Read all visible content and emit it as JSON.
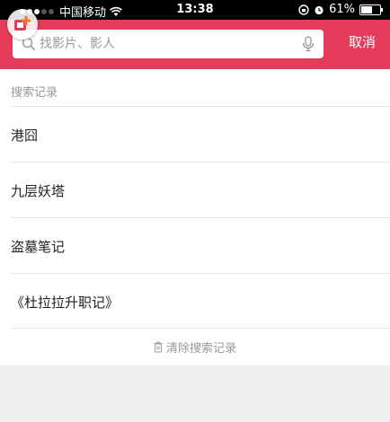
{
  "status_bar": {
    "carrier": "中国移动",
    "time": "13:38",
    "battery": "61%",
    "battery_level": 0.61,
    "icons": [
      "signal-icon",
      "wifi-icon",
      "lock-rotation-icon",
      "alarm-icon",
      "battery-icon"
    ]
  },
  "search": {
    "placeholder": "找影片、影人",
    "value": "",
    "cancel_label": "取消"
  },
  "history": {
    "title": "搜索记录",
    "items": [
      {
        "label": "港囧"
      },
      {
        "label": "九层妖塔"
      },
      {
        "label": "盗墓笔记"
      },
      {
        "label": "《杜拉拉升职记》"
      }
    ],
    "clear_label": "清除搜索记录"
  },
  "colors": {
    "accent": "#e63c5b",
    "background": "#efeff1",
    "text": "#222222",
    "muted": "#999999"
  }
}
